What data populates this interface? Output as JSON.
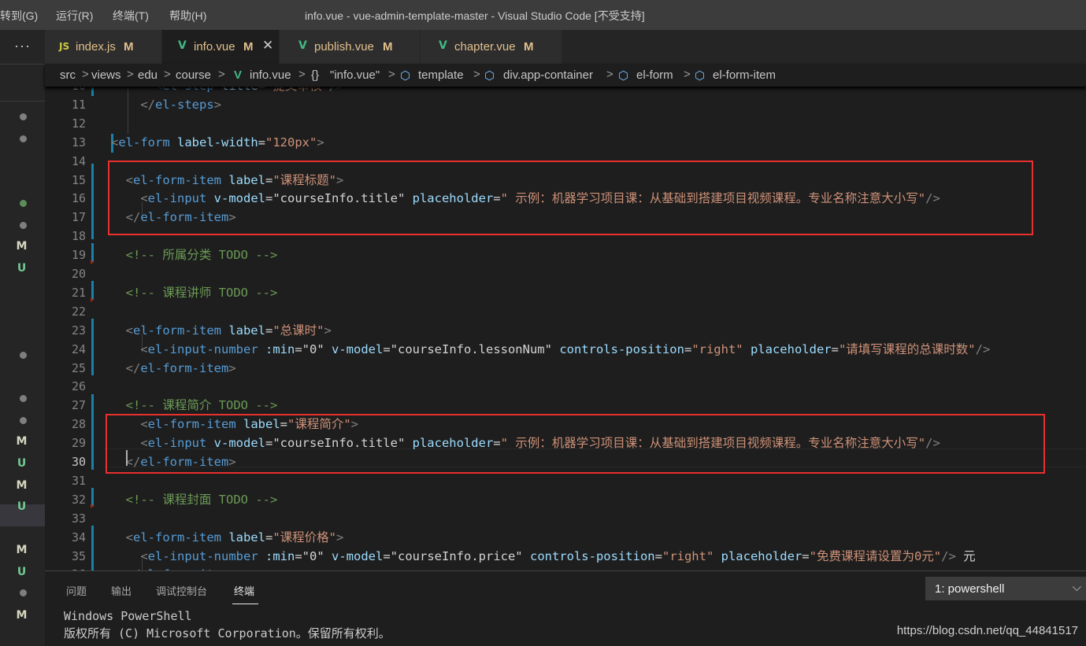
{
  "titlebar": {
    "menu": [
      "转到(G)",
      "运行(R)",
      "终端(T)",
      "帮助(H)"
    ],
    "title": "info.vue - vue-admin-template-master - Visual Studio Code [不受支持]"
  },
  "activitybar": {
    "more": "···",
    "scm_marks": [
      "M",
      "U",
      "M",
      "U",
      "M",
      "U",
      "M",
      "U",
      "M"
    ]
  },
  "tabs": [
    {
      "icon": "JS",
      "label": "index.js",
      "badge": "M"
    },
    {
      "icon": "V",
      "label": "info.vue",
      "badge": "M",
      "close": "✕"
    },
    {
      "icon": "V",
      "label": "publish.vue",
      "badge": "M"
    },
    {
      "icon": "V",
      "label": "chapter.vue",
      "badge": "M"
    }
  ],
  "breadcrumb": {
    "items": [
      "src",
      "views",
      "edu",
      "course",
      "info.vue",
      "\"info.vue\"",
      "template",
      "div.app-container",
      "el-form",
      "el-form-item"
    ],
    "sep": ">",
    "braces": "{}"
  },
  "code": {
    "current_line": "30",
    "lines": [
      {
        "n": "10",
        "tokens": [
          {
            "c": "t-punc",
            "t": "      <"
          },
          {
            "c": "t-tag",
            "t": "el-step"
          },
          {
            "c": "t-attr",
            "t": " title"
          },
          {
            "c": "t-eq",
            "t": "="
          },
          {
            "c": "t-str",
            "t": "\"提交审核\""
          },
          {
            "c": "t-punc",
            "t": "/>"
          }
        ]
      },
      {
        "n": "11",
        "tokens": [
          {
            "c": "t-punc",
            "t": "    </"
          },
          {
            "c": "t-tag",
            "t": "el-steps"
          },
          {
            "c": "t-punc",
            "t": ">"
          }
        ]
      },
      {
        "n": "12",
        "tokens": []
      },
      {
        "n": "13",
        "tokens": [
          {
            "c": "t-punc",
            "t": "<"
          },
          {
            "c": "t-tag",
            "t": "el-form"
          },
          {
            "c": "t-attr",
            "t": " label-width"
          },
          {
            "c": "t-eq",
            "t": "="
          },
          {
            "c": "t-str",
            "t": "\"120px\""
          },
          {
            "c": "t-punc",
            "t": ">"
          }
        ]
      },
      {
        "n": "14",
        "tokens": []
      },
      {
        "n": "15",
        "tokens": [
          {
            "c": "t-punc",
            "t": "  <"
          },
          {
            "c": "t-tag",
            "t": "el-form-item"
          },
          {
            "c": "t-attr",
            "t": " label"
          },
          {
            "c": "t-eq",
            "t": "="
          },
          {
            "c": "t-str",
            "t": "\"课程标题\""
          },
          {
            "c": "t-punc",
            "t": ">"
          }
        ]
      },
      {
        "n": "16",
        "tokens": [
          {
            "c": "t-punc",
            "t": "    <"
          },
          {
            "c": "t-tag",
            "t": "el-input"
          },
          {
            "c": "t-attr",
            "t": " v-model"
          },
          {
            "c": "t-eq",
            "t": "="
          },
          {
            "c": "t-text",
            "t": "\"courseInfo.title\""
          },
          {
            "c": "t-attr",
            "t": " placeholder"
          },
          {
            "c": "t-eq",
            "t": "="
          },
          {
            "c": "t-str",
            "t": "\" 示例：机器学习项目课：从基础到搭建项目视频课程。专业名称注意大小写\""
          },
          {
            "c": "t-punc",
            "t": "/>"
          }
        ]
      },
      {
        "n": "17",
        "tokens": [
          {
            "c": "t-punc",
            "t": "  </"
          },
          {
            "c": "t-tag",
            "t": "el-form-item"
          },
          {
            "c": "t-punc",
            "t": ">"
          }
        ]
      },
      {
        "n": "18",
        "tokens": []
      },
      {
        "n": "19",
        "tokens": [
          {
            "c": "t-cmt",
            "t": "  <!-- 所属分类 TODO -->"
          }
        ]
      },
      {
        "n": "20",
        "tokens": []
      },
      {
        "n": "21",
        "tokens": [
          {
            "c": "t-cmt",
            "t": "  <!-- 课程讲师 TODO -->"
          }
        ]
      },
      {
        "n": "22",
        "tokens": []
      },
      {
        "n": "23",
        "tokens": [
          {
            "c": "t-punc",
            "t": "  <"
          },
          {
            "c": "t-tag",
            "t": "el-form-item"
          },
          {
            "c": "t-attr",
            "t": " label"
          },
          {
            "c": "t-eq",
            "t": "="
          },
          {
            "c": "t-str",
            "t": "\"总课时\""
          },
          {
            "c": "t-punc",
            "t": ">"
          }
        ]
      },
      {
        "n": "24",
        "tokens": [
          {
            "c": "t-punc",
            "t": "    <"
          },
          {
            "c": "t-tag",
            "t": "el-input-number"
          },
          {
            "c": "t-attr",
            "t": " :min"
          },
          {
            "c": "t-eq",
            "t": "="
          },
          {
            "c": "t-text",
            "t": "\"0\""
          },
          {
            "c": "t-attr",
            "t": " v-model"
          },
          {
            "c": "t-eq",
            "t": "="
          },
          {
            "c": "t-text",
            "t": "\"courseInfo.lessonNum\""
          },
          {
            "c": "t-attr",
            "t": " controls-position"
          },
          {
            "c": "t-eq",
            "t": "="
          },
          {
            "c": "t-str",
            "t": "\"right\""
          },
          {
            "c": "t-attr",
            "t": " placeholder"
          },
          {
            "c": "t-eq",
            "t": "="
          },
          {
            "c": "t-str",
            "t": "\"请填写课程的总课时数\""
          },
          {
            "c": "t-punc",
            "t": "/>"
          }
        ]
      },
      {
        "n": "25",
        "tokens": [
          {
            "c": "t-punc",
            "t": "  </"
          },
          {
            "c": "t-tag",
            "t": "el-form-item"
          },
          {
            "c": "t-punc",
            "t": ">"
          }
        ]
      },
      {
        "n": "26",
        "tokens": []
      },
      {
        "n": "27",
        "tokens": [
          {
            "c": "t-cmt",
            "t": "  <!-- 课程简介 TODO -->"
          }
        ]
      },
      {
        "n": "28",
        "tokens": [
          {
            "c": "t-punc",
            "t": "    <"
          },
          {
            "c": "t-tag",
            "t": "el-form-item"
          },
          {
            "c": "t-attr",
            "t": " label"
          },
          {
            "c": "t-eq",
            "t": "="
          },
          {
            "c": "t-str",
            "t": "\"课程简介\""
          },
          {
            "c": "t-punc",
            "t": ">"
          }
        ]
      },
      {
        "n": "29",
        "tokens": [
          {
            "c": "t-punc",
            "t": "    <"
          },
          {
            "c": "t-tag",
            "t": "el-input"
          },
          {
            "c": "t-attr",
            "t": " v-model"
          },
          {
            "c": "t-eq",
            "t": "="
          },
          {
            "c": "t-text",
            "t": "\"courseInfo.title\""
          },
          {
            "c": "t-attr",
            "t": " placeholder"
          },
          {
            "c": "t-eq",
            "t": "="
          },
          {
            "c": "t-str",
            "t": "\" 示例：机器学习项目课：从基础到搭建项目视频课程。专业名称注意大小写\""
          },
          {
            "c": "t-punc",
            "t": "/>"
          }
        ]
      },
      {
        "n": "30",
        "tokens": [
          {
            "c": "t-punc",
            "t": "  </"
          },
          {
            "c": "t-tag",
            "t": "el-form-item"
          },
          {
            "c": "t-punc",
            "t": ">"
          }
        ]
      },
      {
        "n": "31",
        "tokens": []
      },
      {
        "n": "32",
        "tokens": [
          {
            "c": "t-cmt",
            "t": "  <!-- 课程封面 TODO -->"
          }
        ]
      },
      {
        "n": "33",
        "tokens": []
      },
      {
        "n": "34",
        "tokens": [
          {
            "c": "t-punc",
            "t": "  <"
          },
          {
            "c": "t-tag",
            "t": "el-form-item"
          },
          {
            "c": "t-attr",
            "t": " label"
          },
          {
            "c": "t-eq",
            "t": "="
          },
          {
            "c": "t-str",
            "t": "\"课程价格\""
          },
          {
            "c": "t-punc",
            "t": ">"
          }
        ]
      },
      {
        "n": "35",
        "tokens": [
          {
            "c": "t-punc",
            "t": "    <"
          },
          {
            "c": "t-tag",
            "t": "el-input-number"
          },
          {
            "c": "t-attr",
            "t": " :min"
          },
          {
            "c": "t-eq",
            "t": "="
          },
          {
            "c": "t-text",
            "t": "\"0\""
          },
          {
            "c": "t-attr",
            "t": " v-model"
          },
          {
            "c": "t-eq",
            "t": "="
          },
          {
            "c": "t-text",
            "t": "\"courseInfo.price\""
          },
          {
            "c": "t-attr",
            "t": " controls-position"
          },
          {
            "c": "t-eq",
            "t": "="
          },
          {
            "c": "t-str",
            "t": "\"right\""
          },
          {
            "c": "t-attr",
            "t": " placeholder"
          },
          {
            "c": "t-eq",
            "t": "="
          },
          {
            "c": "t-str",
            "t": "\"免费课程请设置为0元\""
          },
          {
            "c": "t-punc",
            "t": "/>"
          },
          {
            "c": "t-text",
            "t": " 元"
          }
        ]
      },
      {
        "n": "36",
        "tokens": [
          {
            "c": "t-punc",
            "t": "  </"
          },
          {
            "c": "t-tag",
            "t": "el-form-item"
          },
          {
            "c": "t-punc",
            "t": ">"
          }
        ]
      }
    ]
  },
  "panel": {
    "tabs": [
      "问题",
      "输出",
      "调试控制台",
      "终端"
    ],
    "active_tab": "终端",
    "terminal_select": "1: powershell",
    "terminal_lines": [
      "Windows PowerShell",
      "版权所有 (C) Microsoft Corporation。保留所有权利。"
    ],
    "watermark": "https://blog.csdn.net/qq_44841517"
  },
  "colors": {
    "highlight_box": "#e8312f",
    "modified": "#e2c08d",
    "vue_icon": "#41b883",
    "accent_blue": "#1b81a8"
  }
}
